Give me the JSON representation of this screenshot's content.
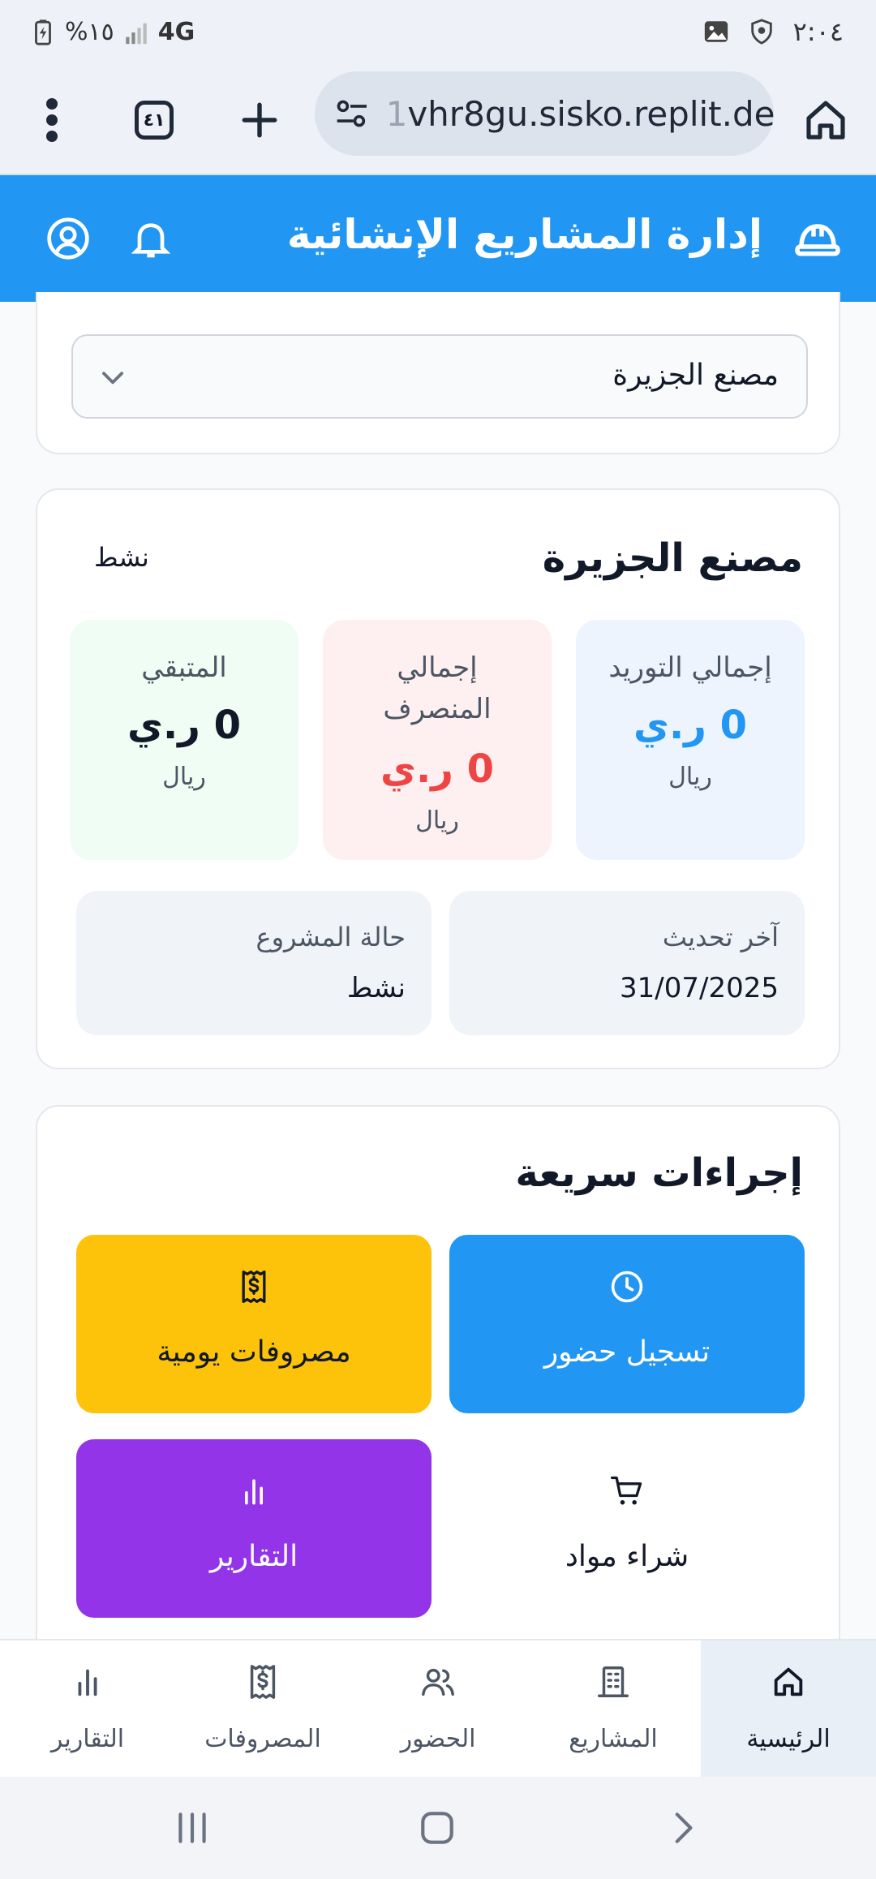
{
  "status_bar": {
    "time": "٢:٠٤",
    "battery": "%١٥",
    "network": "4G"
  },
  "browser": {
    "url_prefix": "1",
    "url": "vhr8gu.sisko.replit.dev",
    "tab_count": "٤١"
  },
  "header": {
    "title": "إدارة المشاريع الإنشائية"
  },
  "project_select": {
    "selected": "مصنع الجزيرة"
  },
  "summary": {
    "project_name": "مصنع الجزيرة",
    "status": "نشط",
    "stats": {
      "supply_label": "إجمالي التوريد",
      "supply_value": "0 ر.ي",
      "supply_unit": "ريال",
      "spent_label_line1": "إجمالي",
      "spent_label_line2": "المنصرف",
      "spent_value": "0 ر.ي",
      "spent_unit": "ريال",
      "remaining_label": "المتبقي",
      "remaining_value": "0 ر.ي",
      "remaining_unit": "ريال"
    },
    "last_update_label": "آخر تحديث",
    "last_update_value": "31/07/2025",
    "project_status_label": "حالة المشروع",
    "project_status_value": "نشط"
  },
  "quick_actions": {
    "title": "إجراءات سريعة",
    "attendance": "تسجيل حضور",
    "daily_expenses": "مصروفات يومية",
    "buy_materials": "شراء مواد",
    "reports": "التقارير"
  },
  "bottom_nav": {
    "home": "الرئيسية",
    "projects": "المشاريع",
    "attendance": "الحضور",
    "expenses": "المصروفات",
    "reports": "التقارير"
  },
  "colors": {
    "primary": "#2196f3",
    "danger": "#ef4444",
    "warning": "#fdc20a",
    "purple": "#9334e9"
  }
}
